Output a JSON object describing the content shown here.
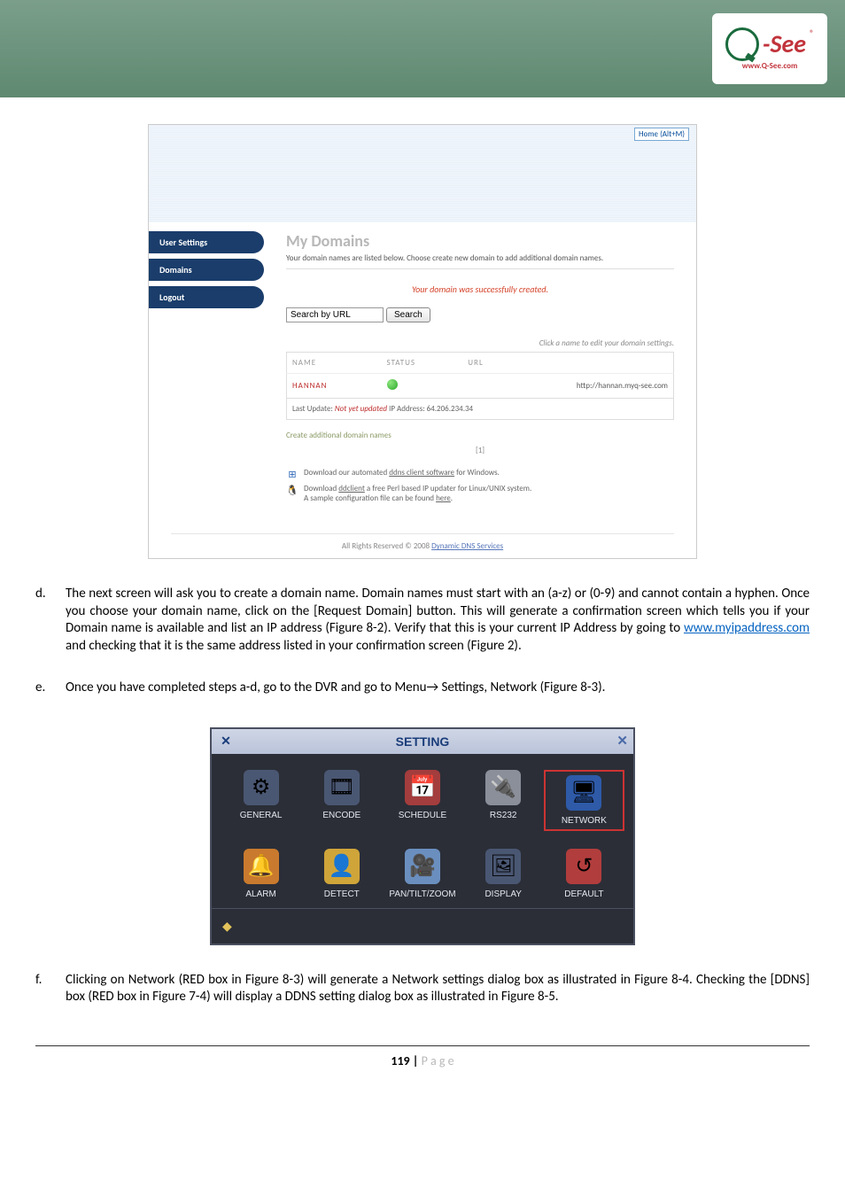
{
  "logo": {
    "see": "-See",
    "url_text": "www.Q-See.com",
    "reg": "®"
  },
  "fig1": {
    "home": "Home (Alt+M)",
    "nav": [
      "User Settings",
      "Domains",
      "Logout"
    ],
    "title": "My Domains",
    "subtitle": "Your domain names are listed below. Choose create new domain to add additional domain names.",
    "success": "Your domain was successfully created.",
    "search_value": "Search by URL",
    "search_btn": "Search",
    "click_edit": "Click a name to edit your domain settings.",
    "th": {
      "name": "NAME",
      "status": "STATUS",
      "url": "URL"
    },
    "row": {
      "name": "HANNAN",
      "url": "http://hannan.myq-see.com"
    },
    "last_update_lbl": "Last Update: ",
    "not_yet": "Not yet updated",
    "ip": "  IP Address: 64.206.234.34",
    "create": "Create additional domain names",
    "pager": "[1]",
    "dl1": "Download our automated ",
    "dl1_link": "ddns client software",
    "dl1_tail": " for Windows.",
    "dl2a": "Download ",
    "dl2_link": "ddclient",
    "dl2b": " a free Perl based IP updater for Linux/UNIX system.",
    "dl2c": "A sample configuration file can be found ",
    "dl2c_link": "here",
    "dl2c_tail": ".",
    "footer_pre": "All Rights Reserved © 2008 ",
    "footer_link": "Dynamic DNS Services"
  },
  "para": {
    "d_marker": "d.",
    "d": "The next screen will ask you to create a domain name.  Domain names must start with an (a-z) or (0-9) and cannot contain a hyphen.  Once you choose your domain name, click on the [Request Domain] button.  This will generate a confirmation screen which tells you if your Domain name is available and list an IP address (Figure 8-2).  Verify that this is your current IP Address by going to ",
    "d_link": "www.myipaddress.com",
    "d_tail": " and checking that it is the same address listed in your confirmation screen (Figure 2).",
    "e_marker": "e.",
    "e": "Once you have completed steps a-d, go to the DVR and go to Menu→ Settings, Network (Figure 8-3).",
    "f_marker": "f.",
    "f": "Clicking on Network (RED box in Figure 8-3) will generate a Network settings dialog box as illustrated in Figure 8-4. Checking the [DDNS] box (RED box in Figure 7-4) will display a DDNS setting dialog box as illustrated in Figure 8-5."
  },
  "fig2": {
    "title": "SETTING",
    "items": [
      {
        "label": "GENERAL",
        "glyph": "⚙",
        "bg": "#4a5773"
      },
      {
        "label": "ENCODE",
        "glyph": "🎞",
        "bg": "#4a5773"
      },
      {
        "label": "SCHEDULE",
        "glyph": "📅",
        "bg": "#a43d3d"
      },
      {
        "label": "RS232",
        "glyph": "🔌",
        "bg": "#8a8f9a"
      },
      {
        "label": "NETWORK",
        "glyph": "🖥",
        "bg": "#2e5aa8",
        "hl": true
      },
      {
        "label": "ALARM",
        "glyph": "🔔",
        "bg": "#c97a2e"
      },
      {
        "label": "DETECT",
        "glyph": "👤",
        "bg": "#cfa53a"
      },
      {
        "label": "PAN/TILT/ZOOM",
        "glyph": "🎥",
        "bg": "#6a8fbf"
      },
      {
        "label": "DISPLAY",
        "glyph": "🖼",
        "bg": "#4a5773"
      },
      {
        "label": "DEFAULT",
        "glyph": "↺",
        "bg": "#b23d3d"
      }
    ]
  },
  "footer": {
    "pnum": "119 | ",
    "pword": "P a g e"
  }
}
